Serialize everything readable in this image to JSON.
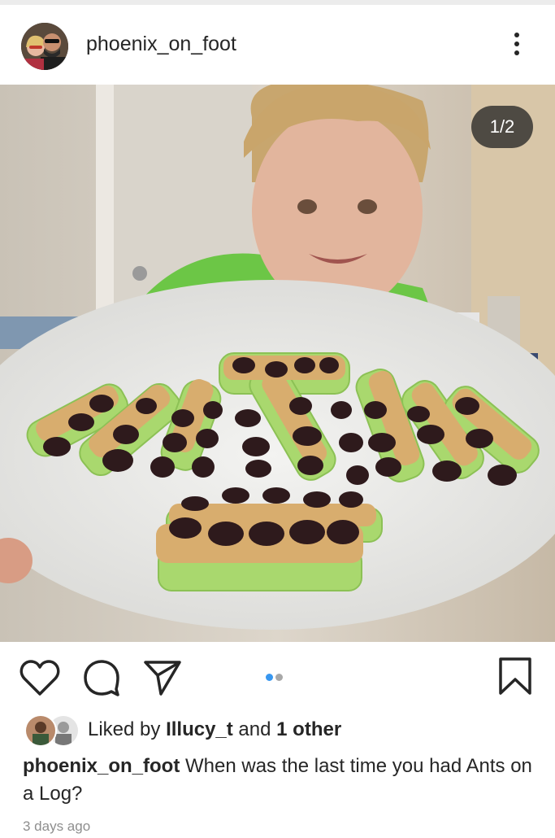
{
  "post": {
    "username": "phoenix_on_foot",
    "image_counter": "1/2",
    "image_alt": "Boy smiling behind a plate of celery sticks topped with peanut butter and raisins",
    "carousel": {
      "total": 2,
      "active": 1
    }
  },
  "icons": {
    "more": "more-vertical-icon",
    "like": "heart-icon",
    "comment": "comment-icon",
    "share": "send-icon",
    "save": "bookmark-icon"
  },
  "likes": {
    "prefix": "Liked by ",
    "user": "Illucy_t",
    "middle": " and ",
    "others": "1 other"
  },
  "caption": {
    "username": "phoenix_on_foot",
    "text": " When was the last time you had Ants on a Log?"
  },
  "timestamp": "3 days ago",
  "colors": {
    "accent_dot": "#3897f0",
    "inactive_dot": "#a8a8a8",
    "text": "#262626",
    "muted": "#8e8e8e"
  }
}
